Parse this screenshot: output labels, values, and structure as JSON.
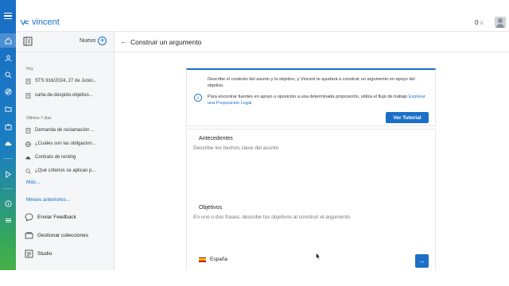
{
  "header": {
    "logo_text": "vincent",
    "credits": "0",
    "credits_caret": "V",
    "brand_color": "#1a6fc6"
  },
  "rail": {
    "icons": [
      "home-icon",
      "user-icon",
      "search-icon",
      "compass-icon",
      "folder-icon",
      "briefcase-icon",
      "cloud-icon",
      "dashes-icon",
      "play-icon",
      "dashes-icon",
      "info-icon",
      "list-icon"
    ]
  },
  "sidebar": {
    "new_label": "Nuevo",
    "today_label": "Hoy",
    "today_items": [
      {
        "label": "STS 916/2024, 27 de Junio...",
        "icon": "document-icon"
      },
      {
        "label": "carta-de-despido-objetivo...",
        "icon": "document-icon"
      }
    ],
    "week_label": "Últimos 7 días",
    "week_items": [
      {
        "label": "Demanda de reclamación ...",
        "icon": "document-icon"
      },
      {
        "label": "¿Cuáles son las obligacion...",
        "icon": "globe-icon"
      },
      {
        "label": "Contrato de renting",
        "icon": "cloud-icon"
      },
      {
        "label": "¿Qué criterios se aplican p...",
        "icon": "search-icon"
      }
    ],
    "more_label": "Más...",
    "previous_months_label": "Meses anteriores...",
    "actions": [
      {
        "label": "Enviar Feedback",
        "icon": "chat-bubble-icon"
      },
      {
        "label": "Gestionar colecciones",
        "icon": "collections-icon"
      },
      {
        "label": "Studio",
        "icon": "studio-icon"
      }
    ]
  },
  "main": {
    "title": "Construir un argumento",
    "info": {
      "line1": "Describe el contexto del asunto y tu objetivo, y Vincent te ayudará a construir un argumento en apoyo del objetivo.",
      "line2_prefix": "Para encontrar fuentes en apoyo u oposición a una determinada proposición, utiliza el flujo de trabajo",
      "line2_link": "Explorar una Proposición Legal",
      "tutorial_button": "Ver Tutorial"
    },
    "form": {
      "antecedentes_label": "Antecedentes",
      "antecedentes_placeholder": "Describe los hechos clave del asunto",
      "objetivos_label": "Objetivos",
      "objetivos_placeholder": "En uno o dos frases, describe tus objetivos al construir el argumento",
      "language": "España",
      "send_icon": "arrow-right-icon"
    }
  }
}
